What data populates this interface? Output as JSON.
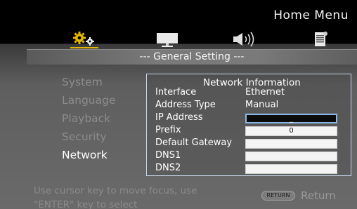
{
  "header": {
    "title": "Home Menu"
  },
  "tabs": [
    {
      "icon": "gear-icon",
      "active": true
    },
    {
      "icon": "display-icon",
      "active": false
    },
    {
      "icon": "speaker-icon",
      "active": false
    },
    {
      "icon": "document-icon",
      "active": false
    }
  ],
  "section": {
    "title": "--- General Setting ---"
  },
  "menu": {
    "items": [
      {
        "label": "System"
      },
      {
        "label": "Language"
      },
      {
        "label": "Playback"
      },
      {
        "label": "Security"
      },
      {
        "label": "Network"
      }
    ],
    "active": "Network"
  },
  "network_panel": {
    "title": "Network Information",
    "interface": {
      "label": "Interface",
      "value": "Ethernet"
    },
    "address_type": {
      "label": "Address Type",
      "value": "Manual"
    },
    "ip_address": {
      "label": "IP Address",
      "value": "_"
    },
    "prefix": {
      "label": "Prefix",
      "value": "0"
    },
    "default_gateway": {
      "label": "Default Gateway",
      "value": ""
    },
    "dns1": {
      "label": "DNS1",
      "value": ""
    },
    "dns2": {
      "label": "DNS2",
      "value": ""
    }
  },
  "footer": {
    "help_line1": "Use cursor key to move focus, use",
    "help_line2": "\"ENTER\" key to select",
    "return_badge": "RETURN",
    "return_label": "Return"
  },
  "colors": {
    "accent": "#e3b400",
    "panel_border": "#c7d7e8",
    "focus_border": "#8db7e6",
    "inactive_text": "#8c8c8c"
  }
}
